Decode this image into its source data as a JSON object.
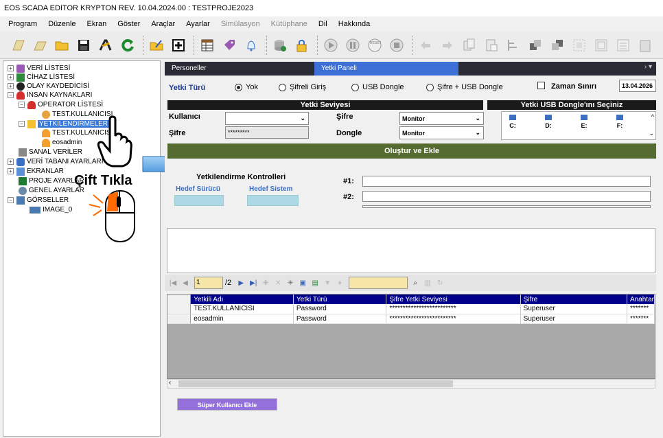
{
  "window": {
    "title": "EOS SCADA EDITOR KRYPTON REV. 10.04.2024.00 : TESTPROJE2023"
  },
  "menu": [
    {
      "label": "Program",
      "disabled": false
    },
    {
      "label": "Düzenle",
      "disabled": false
    },
    {
      "label": "Ekran",
      "disabled": false
    },
    {
      "label": "Göster",
      "disabled": false
    },
    {
      "label": "Araçlar",
      "disabled": false
    },
    {
      "label": "Ayarlar",
      "disabled": false
    },
    {
      "label": "Simülasyon",
      "disabled": true
    },
    {
      "label": "Kütüphane",
      "disabled": true
    },
    {
      "label": "Dil",
      "disabled": false
    },
    {
      "label": "Hakkında",
      "disabled": false
    }
  ],
  "tree": {
    "items": [
      {
        "label": "VERİ LİSTESİ"
      },
      {
        "label": "CİHAZ LİSTESİ"
      },
      {
        "label": "OLAY KAYDEDİCİSİ"
      },
      {
        "label": "İNSAN KAYNAKLARI"
      },
      {
        "label": "OPERATOR LİSTESİ"
      },
      {
        "label": "TEST.KULLANICISI"
      },
      {
        "label": "YETKİLENDİRMELER"
      },
      {
        "label": "TEST.KULLANICISI"
      },
      {
        "label": "eosadmin"
      },
      {
        "label": "SANAL VERİLER"
      },
      {
        "label": "VERİ TABANI AYARLARI"
      },
      {
        "label": "EKRANLAR"
      },
      {
        "label": "PROJE AYARLARI"
      },
      {
        "label": "GENEL AYARLAR"
      },
      {
        "label": "GÖRSELLER"
      },
      {
        "label": "IMAGE_0"
      }
    ]
  },
  "annotation": {
    "text": "Çift Tıkla"
  },
  "tabs": [
    {
      "label": "Personeller",
      "active": false
    },
    {
      "label": "Yetki Paneli",
      "active": true
    }
  ],
  "auth_type": {
    "label": "Yetki Türü",
    "options": [
      {
        "label": "Yok",
        "selected": true
      },
      {
        "label": "Şifreli Giriş",
        "selected": false
      },
      {
        "label": "USB Dongle",
        "selected": false
      },
      {
        "label": "Şifre + USB Dongle",
        "selected": false
      }
    ],
    "time_limit_label": "Zaman Sınırı",
    "time_limit_checked": false,
    "date_value": "13.04.2026"
  },
  "level": {
    "header": "Yetki Seviyesi",
    "user_label": "Kullanıcı",
    "user_value": "",
    "password_label": "Şifre",
    "password_value": "*********",
    "sifre_label": "Şifre",
    "sifre_value": "Monitor",
    "dongle_label": "Dongle",
    "dongle_value": "Monitor"
  },
  "usb": {
    "header": "Yetki USB Dongle'ını Seçiniz",
    "drives": [
      "C:",
      "D:",
      "E:",
      "F:"
    ]
  },
  "create_button": "Oluştur ve Ekle",
  "auth_controls": {
    "title": "Yetkilendirme Kontrolleri",
    "target_drive_label": "Hedef Sürücü",
    "target_system_label": "Hedef Sistem",
    "slot1_label": "#1:",
    "slot2_label": "#2:"
  },
  "navigator": {
    "current_page": "1",
    "total_pages": "/2"
  },
  "grid": {
    "columns": [
      "Yetkili Adı",
      "Yetki Türü",
      "Şifre Yetki Seviyesi",
      "Şifre",
      "Anahtar"
    ],
    "rows": [
      [
        "TEST.KULLANICISI",
        "Password",
        "*************************",
        "Superuser",
        "*******"
      ],
      [
        "eosadmin",
        "Password",
        "*************************",
        "Superuser",
        "*******"
      ]
    ]
  },
  "super_user_button": "Süper Kullanıcı Ekle",
  "colors": {
    "tab_active": "#3d6fd6",
    "header_dark": "#1a1a1a",
    "create_bar": "#556b2f",
    "grid_header": "#00008b",
    "super_button": "#9370db",
    "highlight_input": "#f5e6a8"
  }
}
